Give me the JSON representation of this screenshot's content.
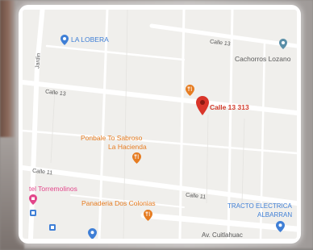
{
  "map": {
    "streets": {
      "calle13_top": "Calle 13",
      "calle13_left": "Calle 13",
      "jardin": "Jardin",
      "calle11_left": "Calle 11",
      "calle11_right": "Calle 11",
      "av_cuitlahuac": "Av. Cuitlahuac"
    },
    "places": {
      "la_lobera": "LA LOBERA",
      "cachorros_lozano": "Cachorros Lozano",
      "selected_address": "Calle 13 313",
      "ponbale_line1": "Ponbale To Sabroso",
      "ponbale_line2": "La Hacienda",
      "torremolinos": "tel Torremolinos",
      "panaderia": "Panaderia Dos Colonias",
      "tracto_line1": "TRACTO ELECTRICA",
      "tracto_line2": "ALBARRAN"
    },
    "colors": {
      "marker": "#d9352a",
      "restaurant": "#e67c21",
      "poi_blue": "#3f7fd6",
      "poi_pink": "#e2458a",
      "park_teal": "#5a8fa8"
    },
    "icons": [
      "map-pin-icon",
      "restaurant-icon",
      "location-pin-icon",
      "shopping-bag-icon",
      "store-icon"
    ]
  }
}
